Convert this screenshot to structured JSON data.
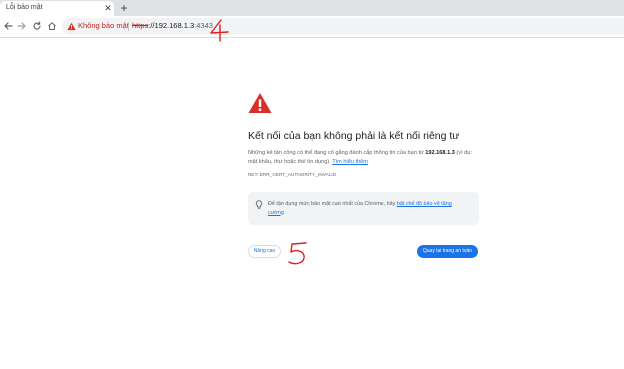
{
  "tab": {
    "title": "Lỗi bảo mật",
    "close_icon": "close-icon",
    "new_tab_icon": "plus-icon"
  },
  "toolbar": {
    "back_icon": "arrow-left-icon",
    "forward_icon": "arrow-right-icon",
    "reload_icon": "reload-icon",
    "home_icon": "home-icon"
  },
  "omnibox": {
    "security_label": "Không bảo mật",
    "url_scheme": "https",
    "url_rest": "://192.168.1.3",
    "url_port": ":4343",
    "warning_icon": "warning-triangle-icon"
  },
  "interstitial": {
    "heading": "Kết nối của bạn không phải là kết nối riêng tư",
    "body_before": "Những kẻ tấn công có thể đang cố gắng đánh cắp thông tin của bạn từ ",
    "body_host": "192.168.1.3",
    "body_after": " (ví dụ: mật khẩu, thư hoặc thẻ tín dụng). ",
    "learn_more": "Tìm hiểu thêm",
    "error_code": "NET::ERR_CERT_AUTHORITY_INVALID",
    "enhanced_before": "Để tận dụng mức bảo mật cao nhất của Chrome, hãy ",
    "enhanced_link": "bật chế độ bảo vệ tăng cường",
    "advanced_button": "Nâng cao",
    "back_button": "Quay lại trang an toàn"
  },
  "annotations": {
    "number_4": "4",
    "number_5": "5",
    "color": "#e02020"
  },
  "colors": {
    "accent": "#1a73e8",
    "danger": "#d93025",
    "tab_strip": "#dfe1e5"
  }
}
